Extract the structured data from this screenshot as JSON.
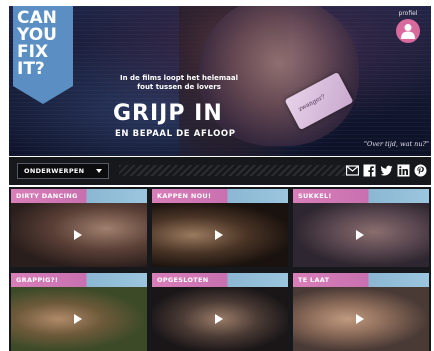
{
  "logo": {
    "lines": [
      "CAN",
      "YOU",
      "FIX",
      "IT?"
    ]
  },
  "hero": {
    "tagline_1": "In de films loopt het helemaal",
    "tagline_2": "fout tussen de lovers",
    "headline": "GRIJP IN",
    "subheadline": "EN BEPAAL DE AFLOOP",
    "quote": "\"Over tijd, wat nu?\"",
    "phone_text": "zwanger?"
  },
  "profile": {
    "label": "profiel",
    "icon": "user-icon"
  },
  "toolbar": {
    "topics_label": "ONDERWERPEN",
    "share_icons": [
      "mail-icon",
      "facebook-icon",
      "twitter-icon",
      "linkedin-icon",
      "pinterest-icon"
    ]
  },
  "videos": [
    {
      "title": "DIRTY DANCING"
    },
    {
      "title": "KAPPEN NOU!"
    },
    {
      "title": "SUKKEL!"
    },
    {
      "title": "GRAPPIG?!"
    },
    {
      "title": "OPGESLOTEN"
    },
    {
      "title": "TE LAAT"
    }
  ],
  "colors": {
    "accent_pink": "#d87fb9",
    "accent_blue": "#8bb7d3",
    "logo_blue": "#5b8fc4",
    "avatar_pink": "#d96a9d",
    "toolbar_bg": "#17181c"
  }
}
